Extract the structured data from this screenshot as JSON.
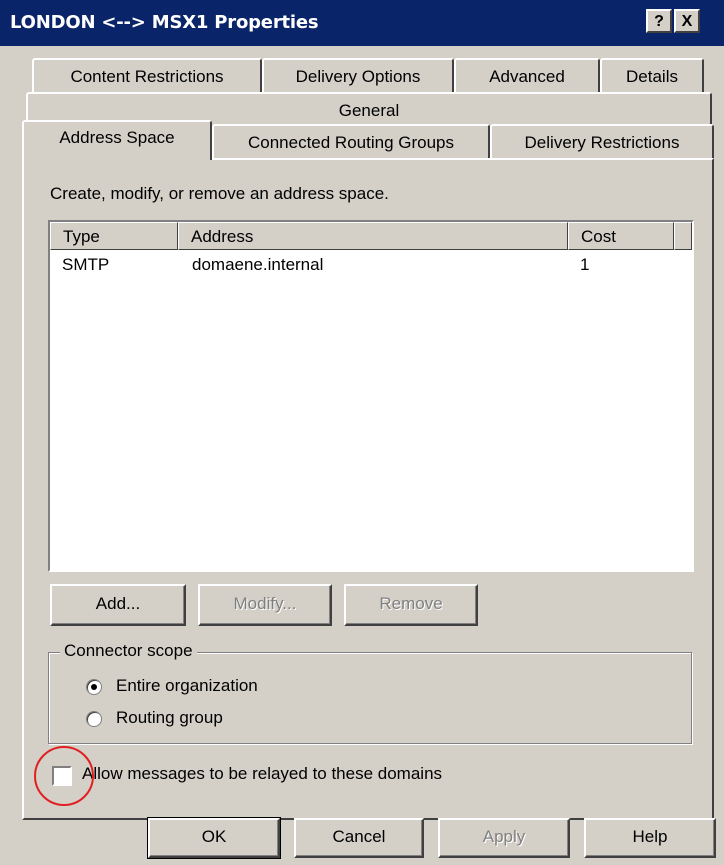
{
  "window": {
    "title": "LONDON <--> MSX1 Properties",
    "help_button": "?",
    "close_button": "X"
  },
  "tabs": {
    "row1": [
      "Content Restrictions",
      "Delivery Options",
      "Advanced",
      "Details"
    ],
    "row2": [
      "General"
    ],
    "row3": [
      "Address Space",
      "Connected Routing Groups",
      "Delivery Restrictions"
    ],
    "active": "Address Space"
  },
  "address_space": {
    "description": "Create, modify, or remove an address space.",
    "columns": [
      "Type",
      "Address",
      "Cost"
    ],
    "rows": [
      {
        "type": "SMTP",
        "address": "domaene.internal",
        "cost": "1"
      }
    ],
    "buttons": {
      "add": "Add...",
      "modify": "Modify...",
      "remove": "Remove"
    }
  },
  "connector_scope": {
    "label": "Connector scope",
    "options": [
      "Entire organization",
      "Routing group"
    ],
    "selected": "Entire organization"
  },
  "relay": {
    "label": "Allow messages to be relayed to these domains",
    "checked": false
  },
  "footer": {
    "ok": "OK",
    "cancel": "Cancel",
    "apply": "Apply",
    "help": "Help"
  },
  "colors": {
    "titlebar": "#0a246a",
    "face": "#d4d0c8",
    "highlight_circle": "#e02020"
  }
}
